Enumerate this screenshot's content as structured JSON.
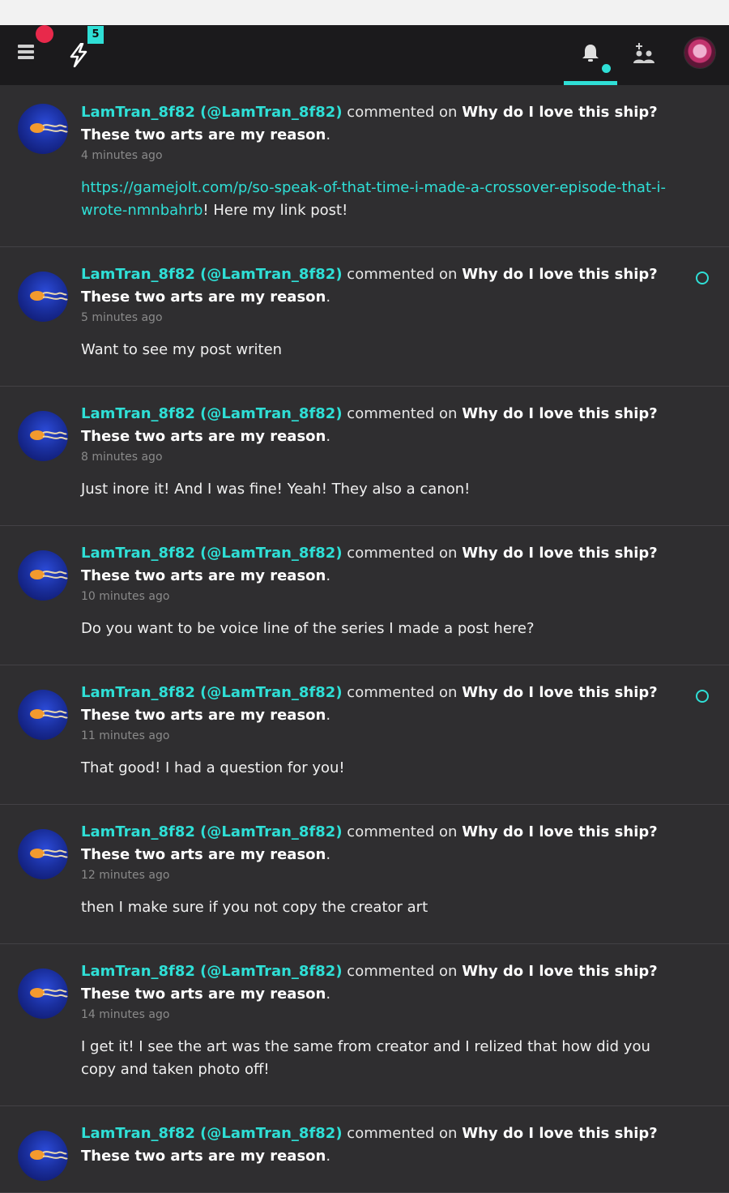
{
  "header": {
    "lightning_count": "5",
    "accent_color": "#2fdfd6",
    "alert_color": "#e8294b",
    "icons": [
      "menu-icon",
      "lightning-icon",
      "bell-icon",
      "friends-icon",
      "user-avatar"
    ]
  },
  "feed": {
    "verb": "commented on",
    "items": [
      {
        "username": "LamTran_8f82 (@LamTran_8f82)",
        "title": "Why do I love this ship? These two arts are my reason",
        "time": "4 minutes ago",
        "link": "https://gamejolt.com/p/so-speak-of-that-time-i-made-a-crossover-episode-that-i-wrote-nmnbahrb",
        "text": "! Here my link post!",
        "unread": false
      },
      {
        "username": "LamTran_8f82 (@LamTran_8f82)",
        "title": "Why do I love this ship? These two arts are my reason",
        "time": "5 minutes ago",
        "text": "Want to see my post writen",
        "unread": true
      },
      {
        "username": "LamTran_8f82 (@LamTran_8f82)",
        "title": "Why do I love this ship? These two arts are my reason",
        "time": "8 minutes ago",
        "text": "Just inore it! And I was fine! Yeah! They also a canon!",
        "unread": false
      },
      {
        "username": "LamTran_8f82 (@LamTran_8f82)",
        "title": "Why do I love this ship? These two arts are my reason",
        "time": "10 minutes ago",
        "text": "Do you want to be voice line of the series I made a post here?",
        "unread": false
      },
      {
        "username": "LamTran_8f82 (@LamTran_8f82)",
        "title": "Why do I love this ship? These two arts are my reason",
        "time": "11 minutes ago",
        "text": "That good! I had a question for you!",
        "unread": true
      },
      {
        "username": "LamTran_8f82 (@LamTran_8f82)",
        "title": "Why do I love this ship? These two arts are my reason",
        "time": "12 minutes ago",
        "text": "then I make sure if you not copy the creator art",
        "unread": false
      },
      {
        "username": "LamTran_8f82 (@LamTran_8f82)",
        "title": "Why do I love this ship? These two arts are my reason",
        "time": "14 minutes ago",
        "text": "I get it! I see the art was the same from creator and I relized that how did you copy and taken photo off!",
        "unread": false
      },
      {
        "username": "LamTran_8f82 (@LamTran_8f82)",
        "title": "Why do I love this ship? These two arts are my reason",
        "time": "",
        "text": "",
        "unread": false
      }
    ]
  }
}
